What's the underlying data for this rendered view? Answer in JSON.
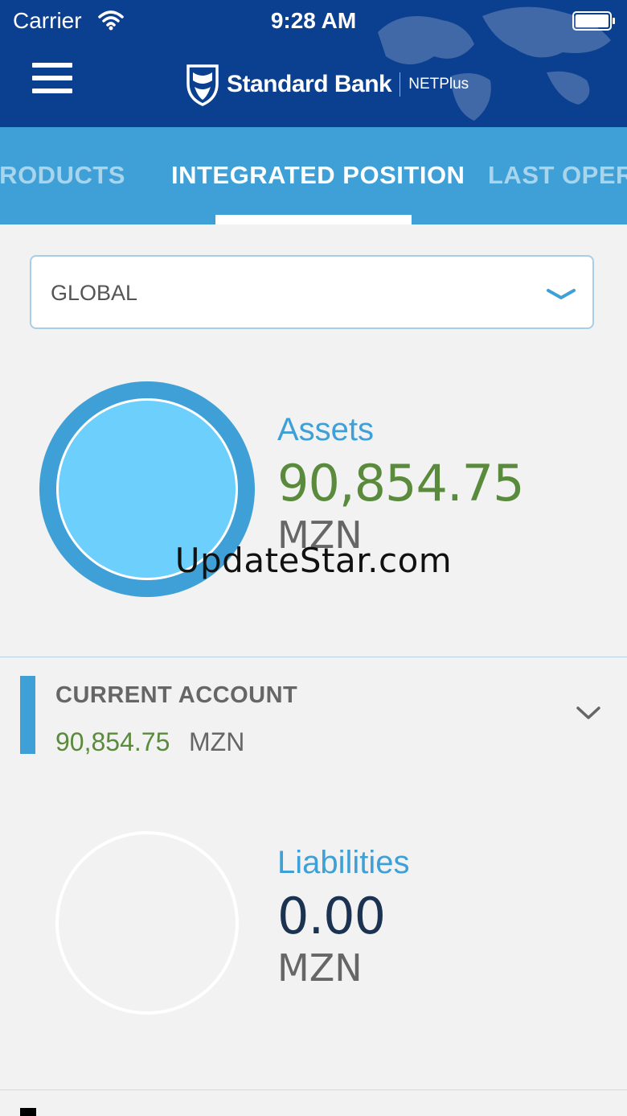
{
  "status_bar": {
    "carrier": "Carrier",
    "time": "9:28 AM"
  },
  "header": {
    "brand": "Standard Bank",
    "product": "NETPlus"
  },
  "tabs": [
    {
      "label": "PRODUCTS"
    },
    {
      "label": "INTEGRATED POSITION",
      "active": true
    },
    {
      "label": "LAST OPERATIONS"
    }
  ],
  "selector": {
    "value": "GLOBAL"
  },
  "assets": {
    "label": "Assets",
    "amount": "90,854.75",
    "currency": "MZN"
  },
  "accounts": [
    {
      "name": "CURRENT ACCOUNT",
      "amount": "90,854.75",
      "currency": "MZN"
    }
  ],
  "liabilities": {
    "label": "Liabilities",
    "amount": "0.00",
    "currency": "MZN"
  },
  "watermark": "UpdateStar.com",
  "colors": {
    "header_bg": "#0b3f8f",
    "tabbar_bg": "#3ea0d6",
    "accent_blue": "#3ea0d6",
    "asset_fill": "#6ccffc",
    "positive_green": "#5a8a3c",
    "dark_navy": "#1b3350"
  }
}
